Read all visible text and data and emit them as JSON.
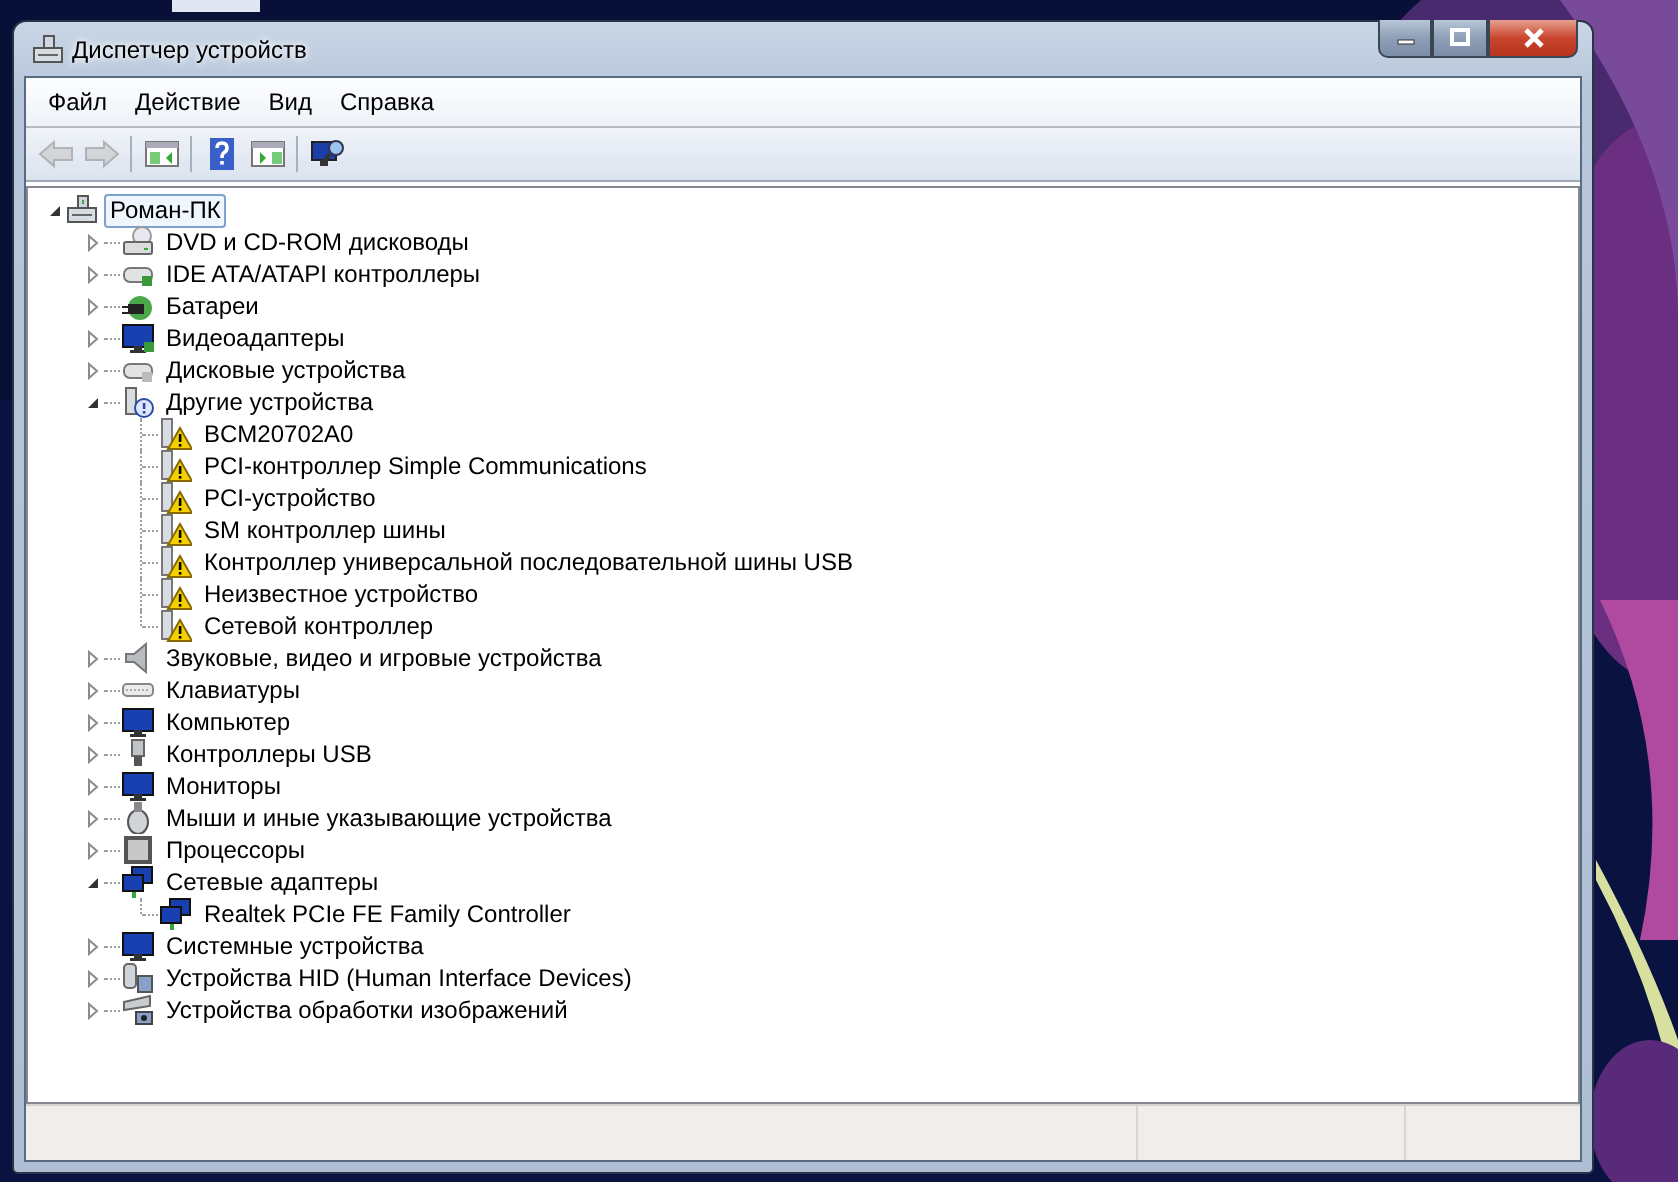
{
  "window": {
    "title": "Диспетчер устройств"
  },
  "menu": [
    "Файл",
    "Действие",
    "Вид",
    "Справка"
  ],
  "toolbar": [
    {
      "kind": "back",
      "disabled": true
    },
    {
      "kind": "forward",
      "disabled": true
    },
    {
      "kind": "separator"
    },
    {
      "kind": "tree-pane",
      "disabled": false
    },
    {
      "kind": "separator"
    },
    {
      "kind": "help",
      "disabled": false
    },
    {
      "kind": "action-pane",
      "disabled": false
    },
    {
      "kind": "separator"
    },
    {
      "kind": "scan",
      "disabled": false
    }
  ],
  "tree": {
    "label": "Роман-ПК",
    "kind": "computer",
    "expanded": true,
    "selected": true,
    "children": [
      {
        "label": "DVD и CD-ROM дисководы",
        "kind": "disc",
        "expanded": false,
        "selected": false
      },
      {
        "label": "IDE ATA/ATAPI контроллеры",
        "kind": "controller",
        "expanded": false,
        "selected": false
      },
      {
        "label": "Батареи",
        "kind": "battery",
        "expanded": false,
        "selected": false
      },
      {
        "label": "Видеоадаптеры",
        "kind": "display",
        "expanded": false,
        "selected": false
      },
      {
        "label": "Дисковые устройства",
        "kind": "disk",
        "expanded": false,
        "selected": false
      },
      {
        "label": "Другие устройства",
        "kind": "unknown",
        "expanded": true,
        "selected": false,
        "children": [
          {
            "label": "BCM20702A0",
            "kind": "warning",
            "selected": false
          },
          {
            "label": "PCI-контроллер Simple Communications",
            "kind": "warning",
            "selected": false
          },
          {
            "label": "PCI-устройство",
            "kind": "warning",
            "selected": false
          },
          {
            "label": "SM контроллер шины",
            "kind": "warning",
            "selected": false
          },
          {
            "label": "Контроллер универсальной последовательной шины USB",
            "kind": "warning",
            "selected": false
          },
          {
            "label": "Неизвестное устройство",
            "kind": "warning",
            "selected": false
          },
          {
            "label": "Сетевой контроллер",
            "kind": "warning",
            "selected": false
          }
        ]
      },
      {
        "label": "Звуковые, видео и игровые устройства",
        "kind": "sound",
        "expanded": false,
        "selected": false
      },
      {
        "label": "Клавиатуры",
        "kind": "keyboard",
        "expanded": false,
        "selected": false
      },
      {
        "label": "Компьютер",
        "kind": "monitor",
        "expanded": false,
        "selected": false
      },
      {
        "label": "Контроллеры USB",
        "kind": "usb",
        "expanded": false,
        "selected": false
      },
      {
        "label": "Мониторы",
        "kind": "monitor",
        "expanded": false,
        "selected": false
      },
      {
        "label": "Мыши и иные указывающие устройства",
        "kind": "mouse",
        "expanded": false,
        "selected": false
      },
      {
        "label": "Процессоры",
        "kind": "cpu",
        "expanded": false,
        "selected": false
      },
      {
        "label": "Сетевые адаптеры",
        "kind": "network",
        "expanded": true,
        "selected": false,
        "children": [
          {
            "label": "Realtek PCIe FE Family Controller",
            "kind": "network",
            "selected": false
          }
        ]
      },
      {
        "label": "Системные устройства",
        "kind": "monitor",
        "expanded": false,
        "selected": false
      },
      {
        "label": "Устройства HID (Human Interface Devices)",
        "kind": "hid",
        "expanded": false,
        "selected": false
      },
      {
        "label": "Устройства обработки изображений",
        "kind": "camera",
        "expanded": false,
        "selected": false
      }
    ]
  }
}
